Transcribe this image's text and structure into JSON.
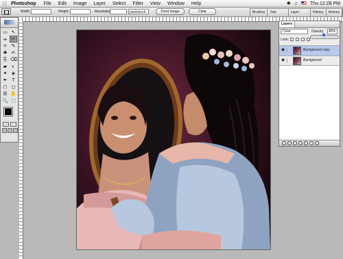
{
  "menubar": {
    "apple": "",
    "app": "Photoshop",
    "items": [
      "File",
      "Edit",
      "Image",
      "Layer",
      "Select",
      "Filter",
      "View",
      "Window",
      "Help"
    ],
    "clock": "Thu 12:28 PM"
  },
  "options": {
    "width_label": "Width:",
    "height_label": "Height:",
    "resolution_label": "Resolution:",
    "resolution_unit": "pixels/inch",
    "front_image": "Front Image",
    "clear": "Clear"
  },
  "palette_well": [
    "Brushes",
    "Tool Presets",
    "Layer Comps",
    "History",
    "Actions"
  ],
  "toolbox": {
    "tools": [
      "▭",
      "↖",
      "⌯",
      "✂",
      "⌗",
      "✎",
      "✚",
      "✍",
      "⎘",
      "⌫",
      "▰",
      "◐",
      "✦",
      "◈",
      "✒",
      "T",
      "⬡",
      "◻",
      "☰",
      "✋",
      "🔍",
      "⬚"
    ]
  },
  "layers": {
    "tab": "Layers",
    "blend_mode": "Color",
    "opacity_label": "Opacity:",
    "opacity": "46%",
    "opacity_fraction": 0.46,
    "lock_label": "Lock:",
    "rows": [
      {
        "name": "Background copy",
        "selected": true
      },
      {
        "name": "Background",
        "selected": false
      }
    ]
  }
}
